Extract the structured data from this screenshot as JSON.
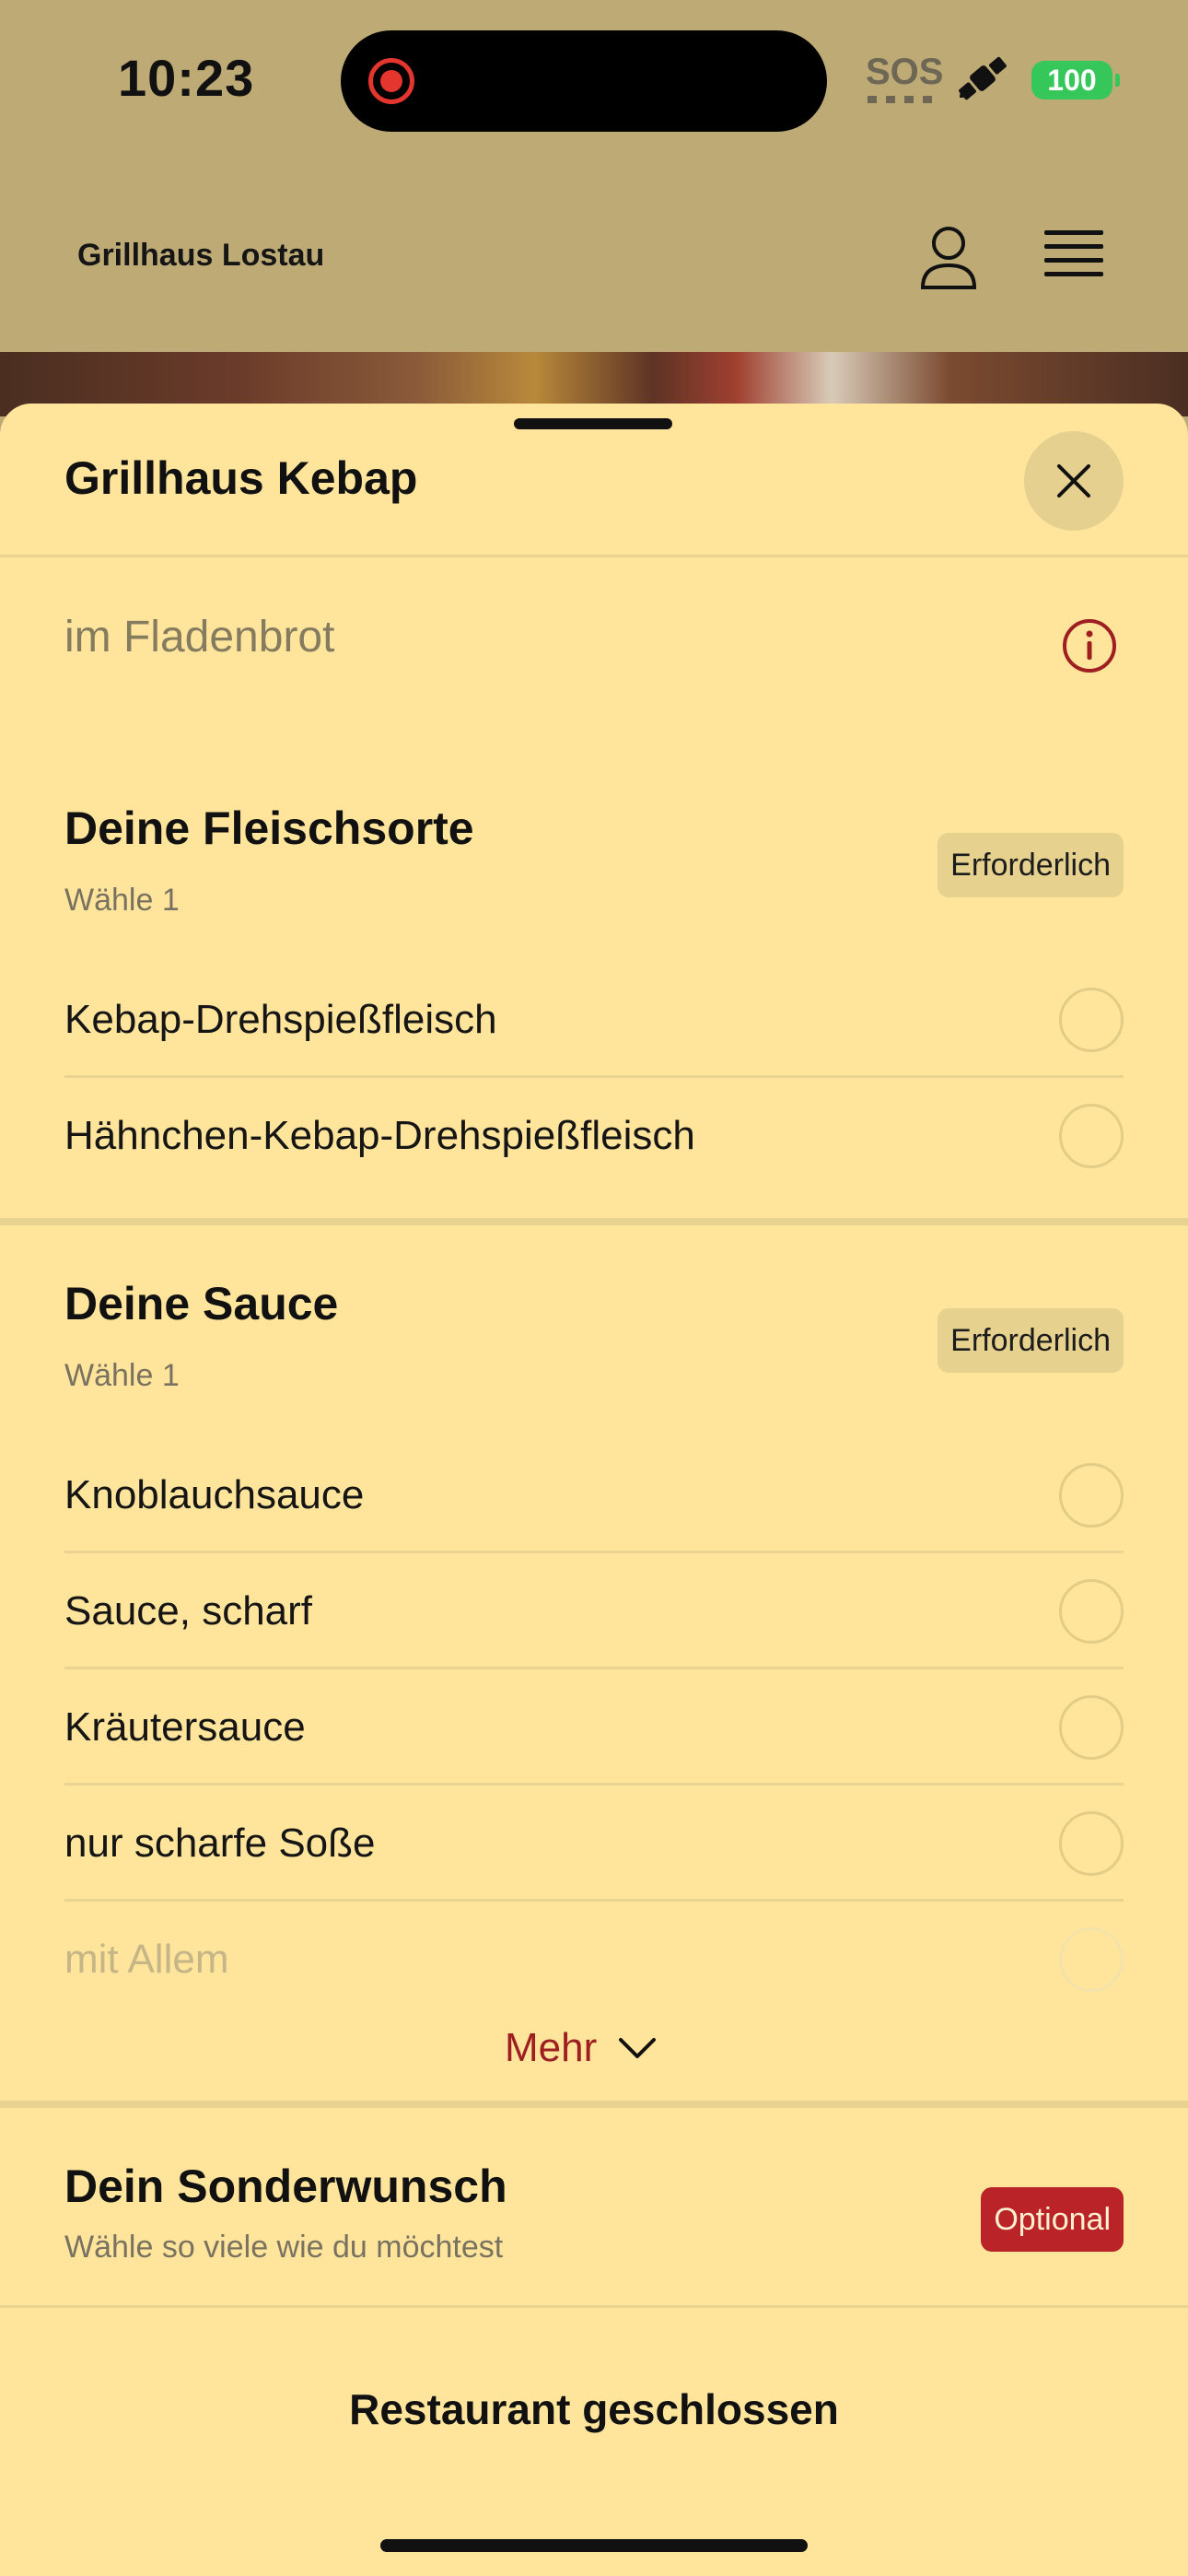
{
  "status_bar": {
    "time": "10:23",
    "sos": "SOS",
    "battery": "100"
  },
  "header": {
    "brand": "Grillhaus Lostau"
  },
  "sheet": {
    "title": "Grillhaus Kebap",
    "subtitle": "im Fladenbrot",
    "groups": [
      {
        "title": "Deine Fleischsorte",
        "hint": "Wähle 1",
        "badge": "Erforderlich",
        "options": [
          "Kebap-Drehspießfleisch",
          "Hähnchen-Kebap-Drehspießfleisch"
        ]
      },
      {
        "title": "Deine Sauce",
        "hint": "Wähle 1",
        "badge": "Erforderlich",
        "options": [
          "Knoblauchsauce",
          "Sauce, scharf",
          "Kräutersauce",
          "nur scharfe Soße",
          "mit Allem"
        ],
        "more_label": "Mehr"
      },
      {
        "title": "Dein Sonderwunsch",
        "hint": "Wähle so viele wie du möchtest",
        "badge": "Optional"
      }
    ],
    "footer_status": "Restaurant geschlossen"
  },
  "colors": {
    "accent": "#ba2328",
    "sheet_bg": "#fee59b",
    "header_bg": "#bdaa75"
  },
  "icons": [
    "record-icon",
    "satellite-icon",
    "user-icon",
    "menu-icon",
    "close-icon",
    "info-icon",
    "chevron-down-icon"
  ]
}
